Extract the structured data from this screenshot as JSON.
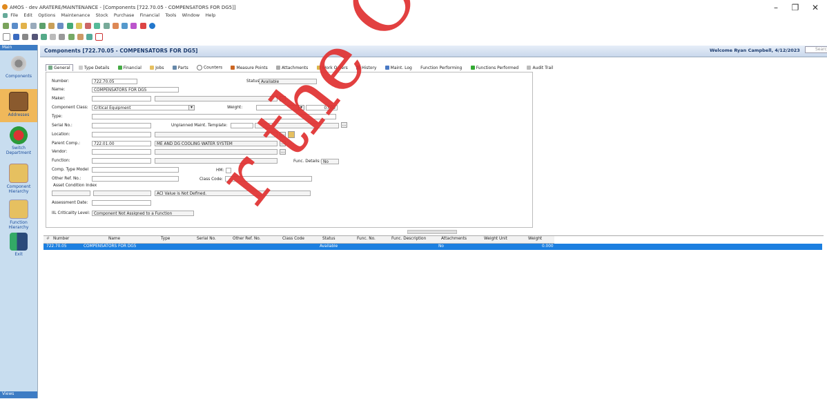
{
  "window": {
    "title": "AMOS - dev ARATERE/MAINTENANCE - [Components [722.70.05 - COMPENSATORS FOR DG5]]",
    "controls": [
      "–",
      "❐",
      "✕"
    ]
  },
  "menu": [
    "File",
    "Edit",
    "Options",
    "Maintenance",
    "Stock",
    "Purchase",
    "Financial",
    "Tools",
    "Window",
    "Help"
  ],
  "leftnav": {
    "header": "Main",
    "footer": "Views",
    "items": [
      {
        "label": "Components",
        "icon": "gear-icon"
      },
      {
        "label": "Addresses",
        "icon": "book-icon"
      },
      {
        "label": "Switch Department",
        "icon": "switch-icon"
      },
      {
        "label": "Component Hierarchy",
        "icon": "folder-icon"
      },
      {
        "label": "Function Hierarchy",
        "icon": "function-icon"
      },
      {
        "label": "Exit",
        "icon": "exit-icon"
      }
    ]
  },
  "header": {
    "title": "Components [722.70.05 - COMPENSATORS FOR DG5]",
    "welcome": "Welcome Ryan Campbell, 4/12/2023",
    "search_placeholder": "Search"
  },
  "tabs": [
    "General",
    "Type Details",
    "Financial",
    "Jobs",
    "Parts",
    "Counters",
    "Measure Points",
    "Attachments",
    "Work Orders",
    "History",
    "Maint. Log",
    "Function Performing",
    "Functions Performed",
    "Audit Trail"
  ],
  "form": {
    "number_label": "Number:",
    "number": "722.70.05",
    "status_label": "Status:",
    "status": "Available",
    "name_label": "Name:",
    "name": "COMPENSATORS FOR DG5",
    "maker_label": "Maker:",
    "class_label": "Component Class:",
    "class": "Critical Equipment",
    "weight_label": "Weight:",
    "weight": "0.000",
    "type_label": "Type:",
    "serial_label": "Serial No.:",
    "unplanned_label": "Unplanned Maint. Template:",
    "location_label": "Location:",
    "parent_label": "Parent Comp.:",
    "parent": "722.01.00",
    "parent_name": "ME AND DG COOLING WATER SYSTEM",
    "vendor_label": "Vendor:",
    "function_label": "Function:",
    "func_details_label": "Func. Details:",
    "func_details": "No",
    "comp_type_model_label": "Comp. Type Model",
    "hm_label": "HM:",
    "other_ref_label": "Other Ref. No.:",
    "class_code_label": "Class Code:",
    "asset_label": "Asset Condition Index",
    "aci_value": "ACI Value is Not Defined.",
    "assessment_label": "Assessment Date:",
    "crit_label": "IIL Criticality Level:",
    "crit": "Component Not Assigned to a Function"
  },
  "grid": {
    "columns": [
      "Number",
      "Name",
      "Type",
      "Serial No.",
      "Other Ref. No.",
      "Class Code",
      "Status",
      "Func. No.",
      "Func. Description",
      "Attachments",
      "Weight Unit",
      "Weight"
    ],
    "rows": [
      {
        "number": "722.70.05",
        "name": "COMPENSATORS FOR DG5",
        "status": "Available",
        "attachments": "No",
        "weight": "0.000"
      }
    ]
  },
  "watermark": "r the Official In"
}
